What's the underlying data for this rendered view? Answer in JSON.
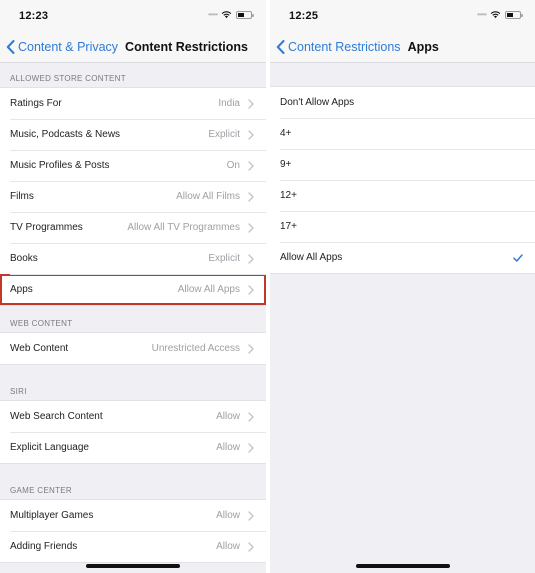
{
  "left_screen": {
    "status": {
      "time": "12:23"
    },
    "nav": {
      "back_label": "Content & Privacy",
      "title": "Content Restrictions"
    },
    "sections": [
      {
        "header": "ALLOWED STORE CONTENT",
        "rows": [
          {
            "label": "Ratings For",
            "value": "India"
          },
          {
            "label": "Music, Podcasts & News",
            "value": "Explicit"
          },
          {
            "label": "Music Profiles & Posts",
            "value": "On"
          },
          {
            "label": "Films",
            "value": "Allow All Films"
          },
          {
            "label": "TV Programmes",
            "value": "Allow All TV Programmes"
          },
          {
            "label": "Books",
            "value": "Explicit"
          },
          {
            "label": "Apps",
            "value": "Allow All Apps",
            "highlighted": true
          }
        ]
      },
      {
        "header": "WEB CONTENT",
        "rows": [
          {
            "label": "Web Content",
            "value": "Unrestricted Access"
          }
        ]
      },
      {
        "header": "SIRI",
        "rows": [
          {
            "label": "Web Search Content",
            "value": "Allow"
          },
          {
            "label": "Explicit Language",
            "value": "Allow"
          }
        ]
      },
      {
        "header": "GAME CENTER",
        "rows": [
          {
            "label": "Multiplayer Games",
            "value": "Allow"
          },
          {
            "label": "Adding Friends",
            "value": "Allow"
          }
        ]
      }
    ]
  },
  "right_screen": {
    "status": {
      "time": "12:25"
    },
    "nav": {
      "back_label": "Content Restrictions",
      "title": "Apps"
    },
    "options": [
      {
        "label": "Don't Allow Apps",
        "selected": false
      },
      {
        "label": "4+",
        "selected": false
      },
      {
        "label": "9+",
        "selected": false
      },
      {
        "label": "12+",
        "selected": false
      },
      {
        "label": "17+",
        "selected": false
      },
      {
        "label": "Allow All Apps",
        "selected": true
      }
    ]
  },
  "colors": {
    "accent": "#2f7cd6",
    "highlight_border": "#c0392b",
    "background": "#efeff4"
  }
}
